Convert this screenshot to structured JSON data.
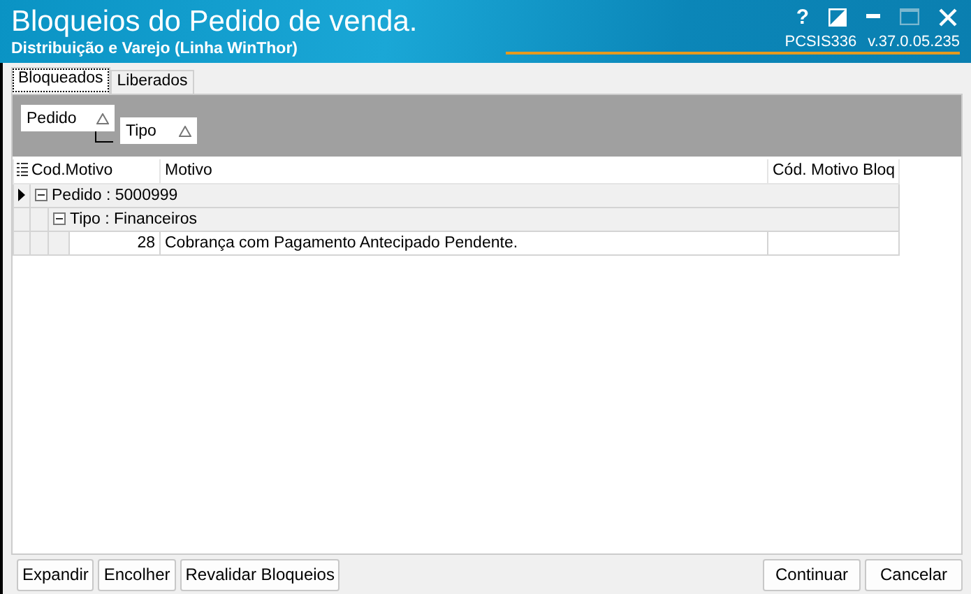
{
  "window": {
    "title": "Bloqueios do Pedido de venda.",
    "subtitle": "Distribuição e Varejo (Linha WinThor)",
    "program_code": "PCSIS336",
    "version": "v.37.0.05.235",
    "help": "?"
  },
  "tabs": [
    {
      "label": "Bloqueados",
      "selected": true
    },
    {
      "label": "Liberados",
      "selected": false
    }
  ],
  "group_panel": [
    "Pedido",
    "Tipo"
  ],
  "table": {
    "columns": [
      "Cod.Motivo",
      "Motivo",
      "Cód. Motivo Bloq"
    ],
    "groups": [
      {
        "label": "Pedido : 5000999",
        "expanded": true,
        "selected": true,
        "children": [
          {
            "label": "Tipo : Financeiros",
            "expanded": true,
            "rows": [
              [
                "28",
                "Cobrança com Pagamento Antecipado Pendente.",
                ""
              ]
            ]
          }
        ]
      }
    ]
  },
  "buttons_left": [
    "Expandir",
    "Encolher",
    "Revalidar Bloqueios"
  ],
  "buttons_right": [
    "Continuar",
    "Cancelar"
  ]
}
